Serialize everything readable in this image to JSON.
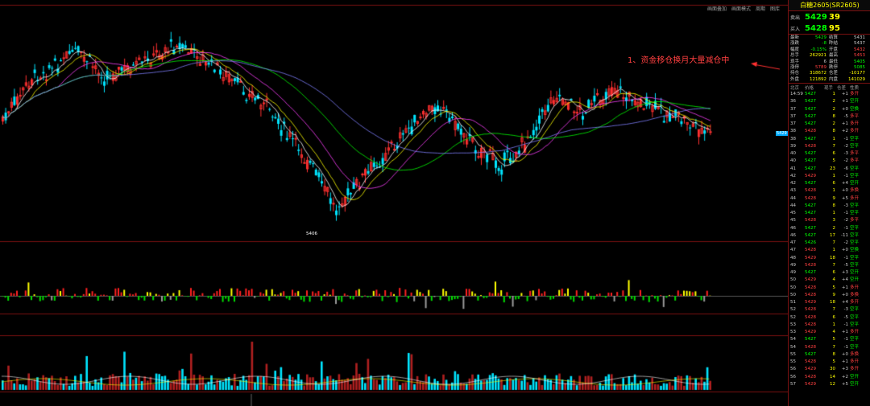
{
  "toolbar": {
    "buttons": [
      "画面叠加",
      "画面模式",
      "周期",
      "图库"
    ]
  },
  "annotation": "1、资金移仓换月大量减仓中",
  "low_label": "5406",
  "price_tag": "5429",
  "colors": {
    "up": "#ff3030",
    "down": "#00e5ff",
    "ma1": "#ffffff",
    "ma2": "#ffff00",
    "ma3": "#ff40ff",
    "ma4": "#00ff00",
    "ma5": "#8080ff",
    "frame": "#7a1010"
  },
  "panel": {
    "title": "白糖2605(SR2605)",
    "ask": {
      "label": "卖出",
      "price": "5429",
      "volume": "39"
    },
    "bid": {
      "label": "买入",
      "price": "5428",
      "volume": "95"
    },
    "stats": [
      [
        "最新",
        "5429",
        "结算",
        "5431"
      ],
      [
        "涨跌",
        "-8",
        "昨结",
        "5437"
      ],
      [
        "幅度",
        "-0.15%",
        "开盘",
        "5432"
      ],
      [
        "总手",
        "262921",
        "最高",
        "5453"
      ],
      [
        "现手",
        "6",
        "最低",
        "5405"
      ],
      [
        "涨停",
        "5789",
        "跌停",
        "5085"
      ],
      [
        "持仓",
        "318672",
        "仓差",
        "-10177"
      ],
      [
        "外盘",
        "121892",
        "内盘",
        "141029"
      ]
    ],
    "ticks_header": [
      "北京",
      "价格",
      "现手",
      "仓差",
      "性质"
    ],
    "ticks_first_time": "14:59",
    "ticks": [
      [
        "14:59",
        "5427",
        "1",
        "+1",
        "多开"
      ],
      [
        "36",
        "5427",
        "2",
        "+1",
        "空开"
      ],
      [
        "37",
        "5427",
        "2",
        "+0",
        "空换"
      ],
      [
        "37",
        "5427",
        "8",
        "-5",
        "多平"
      ],
      [
        "37",
        "5427",
        "2",
        "+1",
        "多开"
      ],
      [
        "38",
        "5428",
        "8",
        "+2",
        "多开"
      ],
      [
        "38",
        "5427",
        "1",
        "-1",
        "空平"
      ],
      [
        "39",
        "5428",
        "7",
        "-2",
        "空平"
      ],
      [
        "40",
        "5427",
        "6",
        "-3",
        "多平"
      ],
      [
        "40",
        "5427",
        "5",
        "-2",
        "多平"
      ],
      [
        "41",
        "5427",
        "23",
        "-6",
        "空平"
      ],
      [
        "42",
        "5429",
        "1",
        "-1",
        "空平"
      ],
      [
        "42",
        "5427",
        "6",
        "+4",
        "空开"
      ],
      [
        "43",
        "5428",
        "1",
        "+0",
        "多换"
      ],
      [
        "44",
        "5428",
        "9",
        "+5",
        "多开"
      ],
      [
        "44",
        "5427",
        "8",
        "-3",
        "空平"
      ],
      [
        "45",
        "5427",
        "1",
        "-1",
        "空平"
      ],
      [
        "45",
        "5428",
        "3",
        "-2",
        "多平"
      ],
      [
        "46",
        "5427",
        "2",
        "-1",
        "空平"
      ],
      [
        "46",
        "5427",
        "17",
        "-11",
        "空平"
      ],
      [
        "47",
        "5426",
        "7",
        "-2",
        "空平"
      ],
      [
        "47",
        "5428",
        "1",
        "+0",
        "空换"
      ],
      [
        "48",
        "5429",
        "18",
        "-1",
        "空平"
      ],
      [
        "49",
        "5428",
        "7",
        "-5",
        "空平"
      ],
      [
        "49",
        "5427",
        "6",
        "+3",
        "空开"
      ],
      [
        "50",
        "5429",
        "4",
        "+4",
        "空开"
      ],
      [
        "50",
        "5428",
        "5",
        "+1",
        "多开"
      ],
      [
        "50",
        "5428",
        "9",
        "+0",
        "多换"
      ],
      [
        "51",
        "5429",
        "18",
        "+4",
        "多开"
      ],
      [
        "52",
        "5428",
        "7",
        "-3",
        "空平"
      ],
      [
        "52",
        "5428",
        "6",
        "-5",
        "空平"
      ],
      [
        "53",
        "5428",
        "1",
        "-1",
        "空平"
      ],
      [
        "53",
        "5429",
        "4",
        "+1",
        "多开"
      ],
      [
        "54",
        "5427",
        "5",
        "-1",
        "空平"
      ],
      [
        "54",
        "5428",
        "7",
        "-1",
        "空平"
      ],
      [
        "55",
        "5427",
        "8",
        "+0",
        "多换"
      ],
      [
        "55",
        "5428",
        "5",
        "+1",
        "多开"
      ],
      [
        "56",
        "5429",
        "30",
        "+3",
        "多开"
      ],
      [
        "56",
        "5428",
        "14",
        "+2",
        "空开"
      ],
      [
        "57",
        "5429",
        "12",
        "+5",
        "空开"
      ]
    ]
  }
}
